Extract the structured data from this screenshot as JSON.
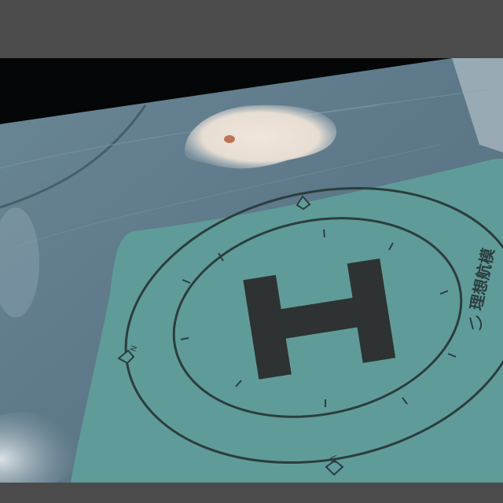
{
  "scene": {
    "description_free": true,
    "helipad": {
      "letter": "H",
      "brand_text": "理想航模",
      "compass_marks": [
        "N",
        "W"
      ]
    },
    "colors": {
      "pad_fill": "#5f9c99",
      "pad_lines": "#2c3d3e",
      "floor": "#637d8d",
      "border": "#4b4b4b"
    }
  }
}
